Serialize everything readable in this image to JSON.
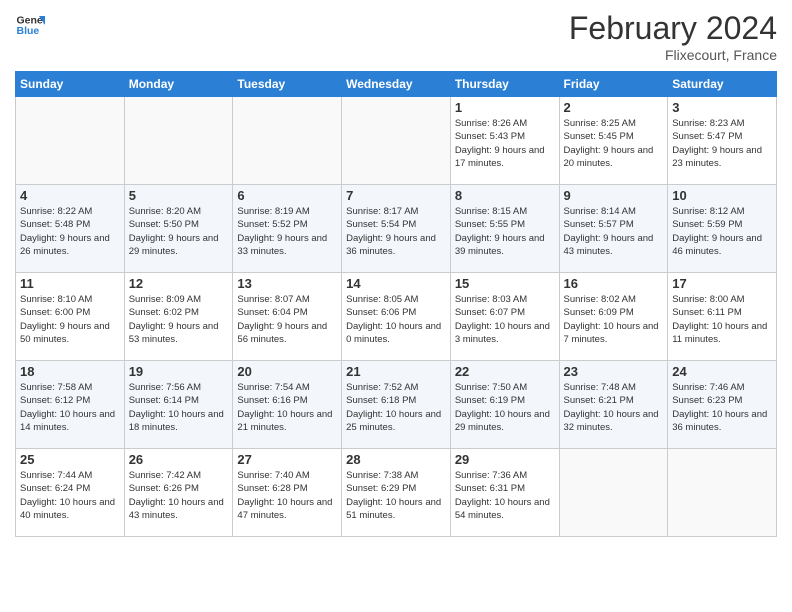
{
  "logo": {
    "line1": "General",
    "line2": "Blue"
  },
  "title": "February 2024",
  "subtitle": "Flixecourt, France",
  "days_header": [
    "Sunday",
    "Monday",
    "Tuesday",
    "Wednesday",
    "Thursday",
    "Friday",
    "Saturday"
  ],
  "weeks": [
    [
      {
        "num": "",
        "info": ""
      },
      {
        "num": "",
        "info": ""
      },
      {
        "num": "",
        "info": ""
      },
      {
        "num": "",
        "info": ""
      },
      {
        "num": "1",
        "info": "Sunrise: 8:26 AM\nSunset: 5:43 PM\nDaylight: 9 hours and 17 minutes."
      },
      {
        "num": "2",
        "info": "Sunrise: 8:25 AM\nSunset: 5:45 PM\nDaylight: 9 hours and 20 minutes."
      },
      {
        "num": "3",
        "info": "Sunrise: 8:23 AM\nSunset: 5:47 PM\nDaylight: 9 hours and 23 minutes."
      }
    ],
    [
      {
        "num": "4",
        "info": "Sunrise: 8:22 AM\nSunset: 5:48 PM\nDaylight: 9 hours and 26 minutes."
      },
      {
        "num": "5",
        "info": "Sunrise: 8:20 AM\nSunset: 5:50 PM\nDaylight: 9 hours and 29 minutes."
      },
      {
        "num": "6",
        "info": "Sunrise: 8:19 AM\nSunset: 5:52 PM\nDaylight: 9 hours and 33 minutes."
      },
      {
        "num": "7",
        "info": "Sunrise: 8:17 AM\nSunset: 5:54 PM\nDaylight: 9 hours and 36 minutes."
      },
      {
        "num": "8",
        "info": "Sunrise: 8:15 AM\nSunset: 5:55 PM\nDaylight: 9 hours and 39 minutes."
      },
      {
        "num": "9",
        "info": "Sunrise: 8:14 AM\nSunset: 5:57 PM\nDaylight: 9 hours and 43 minutes."
      },
      {
        "num": "10",
        "info": "Sunrise: 8:12 AM\nSunset: 5:59 PM\nDaylight: 9 hours and 46 minutes."
      }
    ],
    [
      {
        "num": "11",
        "info": "Sunrise: 8:10 AM\nSunset: 6:00 PM\nDaylight: 9 hours and 50 minutes."
      },
      {
        "num": "12",
        "info": "Sunrise: 8:09 AM\nSunset: 6:02 PM\nDaylight: 9 hours and 53 minutes."
      },
      {
        "num": "13",
        "info": "Sunrise: 8:07 AM\nSunset: 6:04 PM\nDaylight: 9 hours and 56 minutes."
      },
      {
        "num": "14",
        "info": "Sunrise: 8:05 AM\nSunset: 6:06 PM\nDaylight: 10 hours and 0 minutes."
      },
      {
        "num": "15",
        "info": "Sunrise: 8:03 AM\nSunset: 6:07 PM\nDaylight: 10 hours and 3 minutes."
      },
      {
        "num": "16",
        "info": "Sunrise: 8:02 AM\nSunset: 6:09 PM\nDaylight: 10 hours and 7 minutes."
      },
      {
        "num": "17",
        "info": "Sunrise: 8:00 AM\nSunset: 6:11 PM\nDaylight: 10 hours and 11 minutes."
      }
    ],
    [
      {
        "num": "18",
        "info": "Sunrise: 7:58 AM\nSunset: 6:12 PM\nDaylight: 10 hours and 14 minutes."
      },
      {
        "num": "19",
        "info": "Sunrise: 7:56 AM\nSunset: 6:14 PM\nDaylight: 10 hours and 18 minutes."
      },
      {
        "num": "20",
        "info": "Sunrise: 7:54 AM\nSunset: 6:16 PM\nDaylight: 10 hours and 21 minutes."
      },
      {
        "num": "21",
        "info": "Sunrise: 7:52 AM\nSunset: 6:18 PM\nDaylight: 10 hours and 25 minutes."
      },
      {
        "num": "22",
        "info": "Sunrise: 7:50 AM\nSunset: 6:19 PM\nDaylight: 10 hours and 29 minutes."
      },
      {
        "num": "23",
        "info": "Sunrise: 7:48 AM\nSunset: 6:21 PM\nDaylight: 10 hours and 32 minutes."
      },
      {
        "num": "24",
        "info": "Sunrise: 7:46 AM\nSunset: 6:23 PM\nDaylight: 10 hours and 36 minutes."
      }
    ],
    [
      {
        "num": "25",
        "info": "Sunrise: 7:44 AM\nSunset: 6:24 PM\nDaylight: 10 hours and 40 minutes."
      },
      {
        "num": "26",
        "info": "Sunrise: 7:42 AM\nSunset: 6:26 PM\nDaylight: 10 hours and 43 minutes."
      },
      {
        "num": "27",
        "info": "Sunrise: 7:40 AM\nSunset: 6:28 PM\nDaylight: 10 hours and 47 minutes."
      },
      {
        "num": "28",
        "info": "Sunrise: 7:38 AM\nSunset: 6:29 PM\nDaylight: 10 hours and 51 minutes."
      },
      {
        "num": "29",
        "info": "Sunrise: 7:36 AM\nSunset: 6:31 PM\nDaylight: 10 hours and 54 minutes."
      },
      {
        "num": "",
        "info": ""
      },
      {
        "num": "",
        "info": ""
      }
    ]
  ]
}
